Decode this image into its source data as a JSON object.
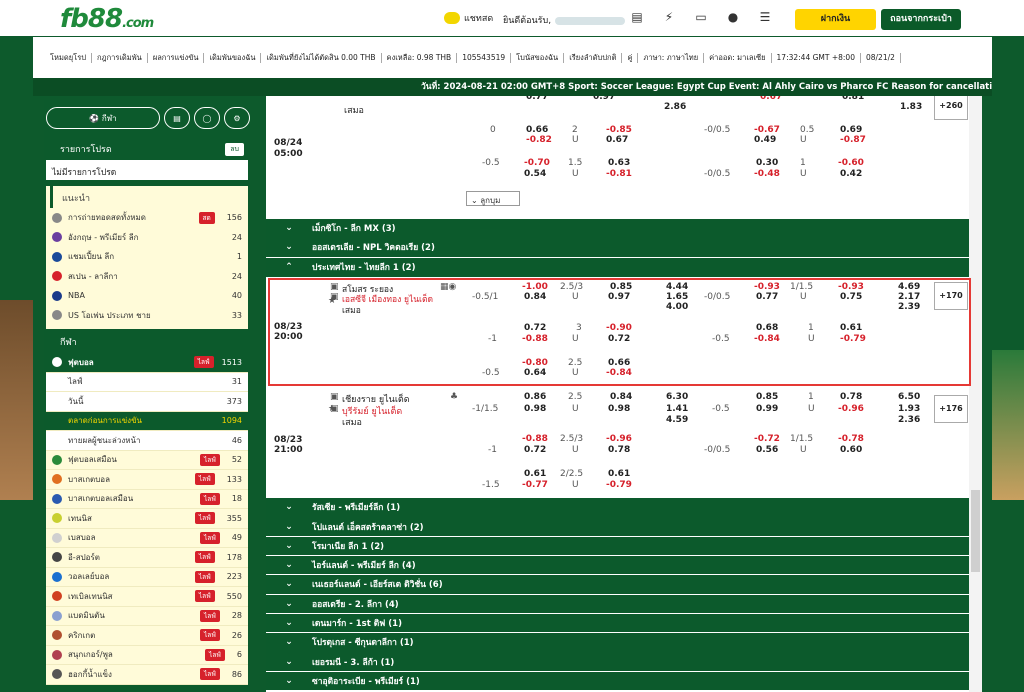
{
  "header": {
    "logo_main": "fb88",
    "logo_suffix": ".com",
    "chat": "แชทสด",
    "welcome": "ยินดีต้อนรับ,",
    "deposit": "ฝากเงิน",
    "withdraw": "ถอนจากกระเป๋า"
  },
  "menu": [
    "โหมดยุโรป",
    "กฎการเดิมพัน",
    "ผลการแข่งขัน",
    "เดิมพันของฉัน",
    "เดิมพันที่ยังไม่ได้ตัดสิน 0.00 THB",
    "คงเหลือ: 0.98 THB",
    "105543519",
    "โบนัสของฉัน",
    "เรียงลำดับปกติ",
    "คู่",
    "ภาษา: ภาษาไทย",
    "ค่าออด: มาเลเซีย",
    "17:32:44 GMT +8:00",
    "08/21/2"
  ],
  "ticker": "วันที่: 2024-08-21 02:00 GMT+8 Sport: Soccer League: Egypt Cup Event: Al Ahly Cairo vs Pharco FC Reason for cancellation: Awarde",
  "sidebar": {
    "tabs": [
      "กีฬา"
    ],
    "promo_title": "รายการโปรด",
    "promo_btn": "ลบ",
    "promo_empty": "ไม่มีรายการโปรด",
    "rec_title": "แนะนำ",
    "rec": [
      {
        "label": "การถ่ายทอดสดทั้งหมด",
        "live": "สด",
        "count": "156"
      },
      {
        "label": "อังกฤษ - พรีเมียร์ ลีก",
        "count": "24"
      },
      {
        "label": "แชมเปี้ยน ลีก",
        "count": "1"
      },
      {
        "label": "สเปน - ลาลีกา",
        "count": "24"
      },
      {
        "label": "NBA",
        "count": "40"
      },
      {
        "label": "US โอเพ่น ประเภท ชาย",
        "count": "33"
      }
    ],
    "sports_title": "กีฬา",
    "football": {
      "label": "ฟุตบอล",
      "live": "ไลฟ์",
      "count": "1513"
    },
    "subs": [
      {
        "label": "ไลฟ์",
        "count": "31"
      },
      {
        "label": "วันนี้",
        "count": "373"
      },
      {
        "label": "ตลาดก่อนการแข่งขัน",
        "count": "1094"
      },
      {
        "label": "ทายผลผู้ชนะล่วงหน้า",
        "count": "46"
      }
    ],
    "sports": [
      {
        "label": "ฟุตบอลเสมือน",
        "live": "ไลฟ์",
        "count": "52"
      },
      {
        "label": "บาสเกตบอล",
        "live": "ไลฟ์",
        "count": "133"
      },
      {
        "label": "บาสเกตบอลเสมือน",
        "live": "ไลฟ์",
        "count": "18"
      },
      {
        "label": "เทนนิส",
        "live": "ไลฟ์",
        "count": "355"
      },
      {
        "label": "เบสบอล",
        "live": "ไลฟ์",
        "count": "49"
      },
      {
        "label": "อี-สปอร์ต",
        "live": "ไลฟ์",
        "count": "178"
      },
      {
        "label": "วอลเลย์บอล",
        "live": "ไลฟ์",
        "count": "223"
      },
      {
        "label": "เทเบิลเทนนิส",
        "live": "ไลฟ์",
        "count": "550"
      },
      {
        "label": "แบดมินตัน",
        "live": "ไลฟ์",
        "count": "28"
      },
      {
        "label": "คริกเกต",
        "live": "ไลฟ์",
        "count": "26"
      },
      {
        "label": "สนุกเกอร์/พูล",
        "live": "ไลฟ์",
        "count": "6"
      },
      {
        "label": "ฮอกกี้น้ำแข็ง",
        "live": "ไลฟ์",
        "count": "86"
      }
    ]
  },
  "collapse": "ลูกบุม",
  "top_match": {
    "team1": "",
    "draw": "เสมอ",
    "date": "08/24",
    "time": "05:00",
    "more": "+260"
  },
  "leagues_top": [
    "เม็กซิโก - ลีก MX (3)",
    "ออสเตรเลีย - NPL วิคตอเรีย (2)",
    "ประเทศไทย - ไทยลีก 1 (2)"
  ],
  "match1": {
    "team1": "สโมสร ระยอง",
    "team2": "เอสซีจี เมืองทอง ยูไนเต็ด",
    "draw": "เสมอ",
    "date": "08/23",
    "time": "20:00",
    "more": "+170"
  },
  "match2": {
    "team1": "เชียงราย ยูไนเต็ด",
    "team2": "บุรีรัมย์ ยูไนเต็ด",
    "draw": "เสมอ",
    "date": "08/23",
    "time": "21:00",
    "more": "+176"
  },
  "leagues_bottom": [
    "รัสเซีย - พรีเมียร์ลีก (1)",
    "โปแลนด์ เอ็คสตร้าคลาซ่า (2)",
    "โรมาเนีย ลีก 1 (2)",
    "ไอร์แลนด์ - พรีเมียร์ ลีก (4)",
    "เนเธอร์แลนด์ - เอียร์สเต ดิวิชั่น (6)",
    "ออสเตรีย - 2. ลีกา (4)",
    "เดนมาร์ก - 1st ดิฟ (1)",
    "โปรตุเกส - ซีกุนดาลีกา (1)",
    "เยอรมนี - 3. ลีก้า (1)",
    "ซาอุดิอาระเบีย - พรีเมียร์ (1)"
  ]
}
